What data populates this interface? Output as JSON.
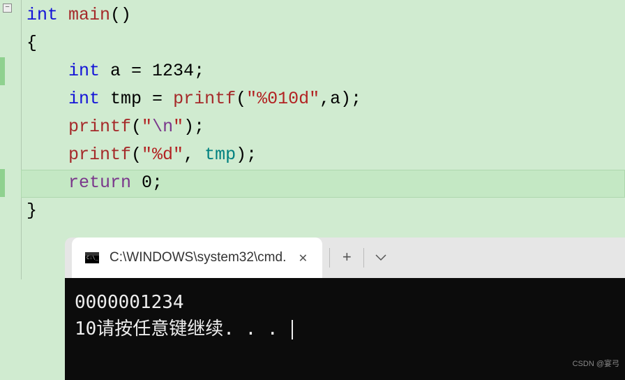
{
  "code": {
    "l1_kw": "int",
    "l1_fn": " main",
    "l1_end": "()",
    "l2": "{",
    "l3_kw": "    int",
    "l3_rest": " a = ",
    "l3_num": "1234",
    "l3_semi": ";",
    "l4_kw": "    int",
    "l4_tmp": " tmp ",
    "l4_eq": "= ",
    "l4_fn": "printf",
    "l4_open": "(",
    "l4_str": "\"%010d\"",
    "l4_args": ",a);",
    "l5": "",
    "l6_fn": "    printf",
    "l6_open": "(",
    "l6_q1": "\"",
    "l6_esc": "\\n",
    "l6_q2": "\"",
    "l6_close": ");",
    "l7_fn": "    printf",
    "l7_open": "(",
    "l7_str": "\"%d\"",
    "l7_comma": ", ",
    "l7_tmp": "tmp",
    "l7_close": ");",
    "l8_kw": "    return",
    "l8_val": " 0",
    "l8_semi": ";",
    "l9": "}"
  },
  "terminal": {
    "tab_title": "C:\\WINDOWS\\system32\\cmd.",
    "output_line1": "0000001234",
    "output_line2": "10请按任意键继续. . . "
  },
  "watermark": "CSDN @宴弓",
  "fold_symbol": "−"
}
